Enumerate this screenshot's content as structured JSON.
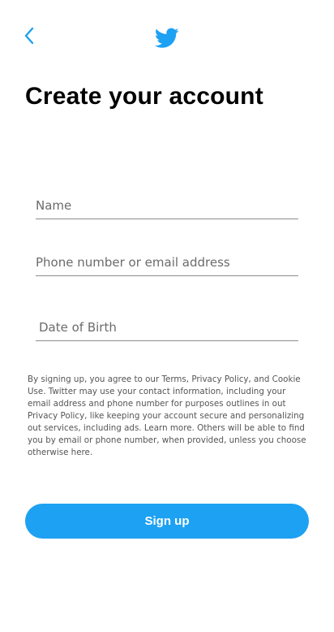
{
  "header": {
    "back_icon": "chevron-left-icon",
    "logo_icon": "twitter-bird-icon"
  },
  "title": "Create your account",
  "form": {
    "name_placeholder": "Name",
    "contact_placeholder": "Phone number or email address",
    "dob_placeholder": "Date of Birth"
  },
  "legal_text": "By signing up, you agree to our Terms, Privacy Policy, and Cookie Use. Twitter may use your contact information, including your email address and phone number for purposes outlines in out Privacy Policy, like keeping your account secure and personalizing out services, including ads. Learn more. Others will be able to find you by email or phone number, when provided,  unless you choose otherwise here.",
  "signup_label": "Sign up",
  "colors": {
    "brand": "#1da1f2",
    "background": "#ffffff"
  }
}
